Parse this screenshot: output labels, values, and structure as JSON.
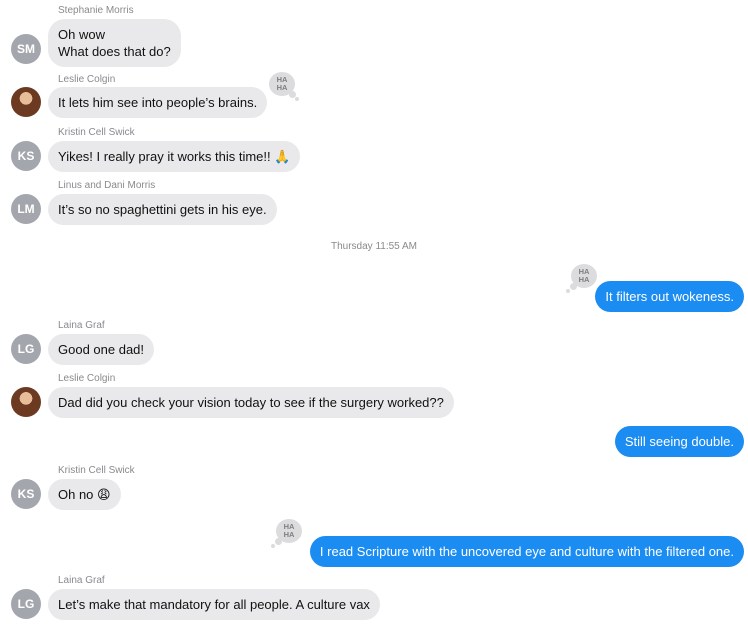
{
  "conversation": {
    "timestamp": "Thursday 11:55 AM",
    "reaction_label": "HA HA",
    "reaction_icon": "haha-tapback-icon",
    "colors": {
      "outgoing": "#1b8cf1",
      "incoming": "#e9e9eb",
      "avatar": "#a3a6ad"
    },
    "messages": [
      {
        "sender": "Stephanie Morris",
        "initials": "SM",
        "lines": [
          "Oh wow",
          "What does that do?"
        ]
      },
      {
        "sender": "Leslie Colgin",
        "initials": "",
        "lines": [
          "It lets him see into people’s brains."
        ],
        "reaction": "haha"
      },
      {
        "sender": "Kristin Cell Swick",
        "initials": "KS",
        "lines": [
          "Yikes! I really pray it works this time!! 🙏"
        ]
      },
      {
        "sender": "Linus and Dani Morris",
        "initials": "LM",
        "lines": [
          "It’s so no spaghettini gets in his eye."
        ]
      },
      {
        "sender": "Me",
        "lines": [
          "It filters out wokeness."
        ],
        "reaction": "haha"
      },
      {
        "sender": "Laina Graf",
        "initials": "LG",
        "lines": [
          "Good one dad!"
        ]
      },
      {
        "sender": "Leslie Colgin",
        "initials": "",
        "lines": [
          "Dad did you check your vision today to see if the surgery worked??"
        ]
      },
      {
        "sender": "Me",
        "lines": [
          "Still seeing double."
        ]
      },
      {
        "sender": "Kristin Cell Swick",
        "initials": "KS",
        "lines": [
          "Oh no 😩"
        ]
      },
      {
        "sender": "Me",
        "lines": [
          "I read Scripture with the uncovered eye and culture with the filtered one."
        ],
        "reaction": "haha"
      },
      {
        "sender": "Laina Graf",
        "initials": "LG",
        "lines": [
          "Let’s make that mandatory for all people. A culture vax"
        ]
      }
    ]
  }
}
